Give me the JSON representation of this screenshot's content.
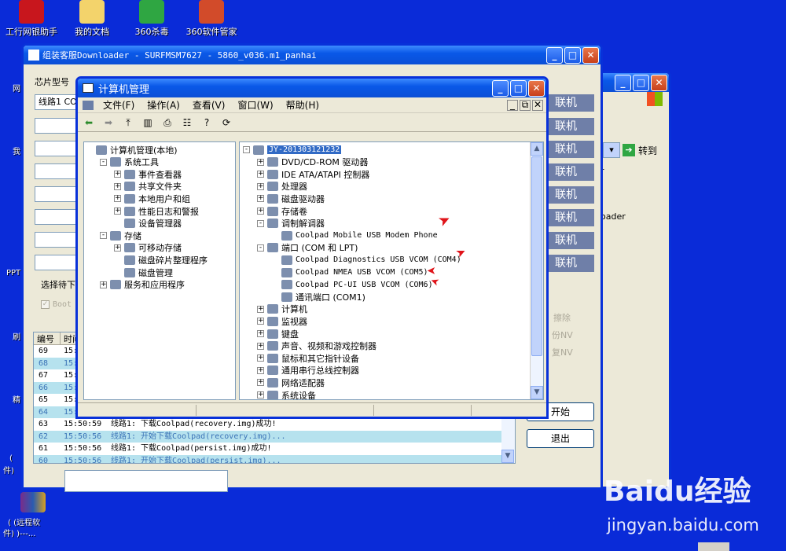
{
  "desktop": {
    "icons": [
      {
        "label": "工行网银助手",
        "color": "#c8161d"
      },
      {
        "label": "我的文档",
        "color": "#f3d36b"
      },
      {
        "label": "360杀毒",
        "color": "#2fa642"
      },
      {
        "label": "360软件管家",
        "color": "#d24b2a"
      }
    ],
    "left_strip": [
      "网",
      "我",
      "PPT",
      "刷",
      "精",
      "(",
      "件)",
      "( (远程软",
      "件) )---..."
    ]
  },
  "downloader": {
    "title": "组装客服Downloader - SURFMSM7627 - 5860_v036.m1_panhai",
    "chip_label": "芯片型号",
    "line_label": "线路1",
    "line_value": "CO",
    "lianji_label": "联机",
    "select_label": "选择待下",
    "boot_label": "Boot",
    "log_headers": [
      "编号",
      "时间"
    ],
    "log_rows": [
      {
        "id": "69",
        "time": "15:5",
        "msg": ""
      },
      {
        "id": "68",
        "time": "15:5",
        "msg": ""
      },
      {
        "id": "67",
        "time": "15:5",
        "msg": ""
      },
      {
        "id": "66",
        "time": "15:5",
        "msg": ""
      },
      {
        "id": "65",
        "time": "15:5",
        "msg": ""
      },
      {
        "id": "64",
        "time": "15:5",
        "msg": ""
      },
      {
        "id": "63",
        "time": "15:50:59",
        "msg": "线路1: 下载Coolpad(recovery.img)成功!"
      },
      {
        "id": "62",
        "time": "15:50:56",
        "msg": "线路1: 开始下载Coolpad(recovery.img)..."
      },
      {
        "id": "61",
        "time": "15:50:56",
        "msg": "线路1: 下载Coolpad(persist.img)成功!"
      },
      {
        "id": "60",
        "time": "15:50:56",
        "msg": "线路1: 开始下载Coolpad(persist.img)..."
      }
    ],
    "start_button": "开始",
    "exit_button": "退出",
    "side_texts": [
      "擦除",
      "份NV",
      "复NV"
    ]
  },
  "rightwin": {
    "goto_label": "转到",
    "texts": [
      "r",
      "oader"
    ]
  },
  "compmgmt": {
    "title": "计算机管理",
    "menu": [
      "文件(F)",
      "操作(A)",
      "查看(V)",
      "窗口(W)",
      "帮助(H)"
    ],
    "left_tree": [
      {
        "label": "计算机管理(本地)",
        "indent": 0,
        "exp": ""
      },
      {
        "label": "系统工具",
        "indent": 1,
        "exp": "-"
      },
      {
        "label": "事件查看器",
        "indent": 2,
        "exp": "+"
      },
      {
        "label": "共享文件夹",
        "indent": 2,
        "exp": "+"
      },
      {
        "label": "本地用户和组",
        "indent": 2,
        "exp": "+"
      },
      {
        "label": "性能日志和警报",
        "indent": 2,
        "exp": "+"
      },
      {
        "label": "设备管理器",
        "indent": 2,
        "exp": ""
      },
      {
        "label": "存储",
        "indent": 1,
        "exp": "-"
      },
      {
        "label": "可移动存储",
        "indent": 2,
        "exp": "+"
      },
      {
        "label": "磁盘碎片整理程序",
        "indent": 2,
        "exp": ""
      },
      {
        "label": "磁盘管理",
        "indent": 2,
        "exp": ""
      },
      {
        "label": "服务和应用程序",
        "indent": 1,
        "exp": "+"
      }
    ],
    "right_tree": [
      {
        "label": "JY-201303121232",
        "indent": 0,
        "exp": "-",
        "mono": true,
        "selected": true
      },
      {
        "label": "DVD/CD-ROM 驱动器",
        "indent": 1,
        "exp": "+"
      },
      {
        "label": "IDE ATA/ATAPI 控制器",
        "indent": 1,
        "exp": "+"
      },
      {
        "label": "处理器",
        "indent": 1,
        "exp": "+"
      },
      {
        "label": "磁盘驱动器",
        "indent": 1,
        "exp": "+"
      },
      {
        "label": "存储卷",
        "indent": 1,
        "exp": "+"
      },
      {
        "label": "调制解调器",
        "indent": 1,
        "exp": "-"
      },
      {
        "label": "Coolpad Mobile USB Modem Phone",
        "indent": 2,
        "exp": "",
        "mono": true
      },
      {
        "label": "端口 (COM 和 LPT)",
        "indent": 1,
        "exp": "-"
      },
      {
        "label": "Coolpad Diagnostics USB VCOM (COM4)",
        "indent": 2,
        "exp": "",
        "mono": true
      },
      {
        "label": "Coolpad NMEA USB VCOM (COM5)",
        "indent": 2,
        "exp": "",
        "mono": true
      },
      {
        "label": "Coolpad PC-UI USB VCOM (COM6)",
        "indent": 2,
        "exp": "",
        "mono": true
      },
      {
        "label": "通讯端口 (COM1)",
        "indent": 2,
        "exp": ""
      },
      {
        "label": "计算机",
        "indent": 1,
        "exp": "+"
      },
      {
        "label": "监视器",
        "indent": 1,
        "exp": "+"
      },
      {
        "label": "键盘",
        "indent": 1,
        "exp": "+"
      },
      {
        "label": "声音、视频和游戏控制器",
        "indent": 1,
        "exp": "+"
      },
      {
        "label": "鼠标和其它指针设备",
        "indent": 1,
        "exp": "+"
      },
      {
        "label": "通用串行总线控制器",
        "indent": 1,
        "exp": "+"
      },
      {
        "label": "网络适配器",
        "indent": 1,
        "exp": "+"
      },
      {
        "label": "系统设备",
        "indent": 1,
        "exp": "+"
      }
    ]
  },
  "watermark": {
    "brand": "Baidu经验",
    "url": "jingyan.baidu.com"
  }
}
